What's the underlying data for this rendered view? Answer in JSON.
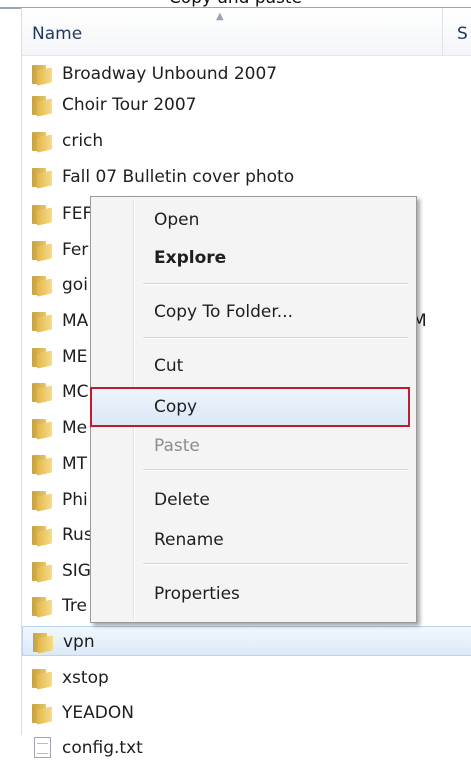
{
  "header": {
    "top_caption": "Copy and paste",
    "column_name": "Name",
    "column_next": "S"
  },
  "items": [
    {
      "label": "Broadway Unbound 2007",
      "type": "folder"
    },
    {
      "label": "Choir Tour 2007",
      "type": "folder"
    },
    {
      "label": "crich",
      "type": "folder"
    },
    {
      "label": "Fall 07 Bulletin cover photo",
      "type": "folder"
    },
    {
      "label": "FEF",
      "type": "folder"
    },
    {
      "label": "Fer",
      "type": "folder"
    },
    {
      "label": "goi",
      "type": "folder"
    },
    {
      "label": "MA",
      "type": "folder"
    },
    {
      "label": "ME",
      "type": "folder"
    },
    {
      "label": "MC",
      "type": "folder"
    },
    {
      "label": "Me",
      "type": "folder"
    },
    {
      "label": "MT",
      "type": "folder"
    },
    {
      "label": "Phi",
      "type": "folder"
    },
    {
      "label": "Rus",
      "type": "folder"
    },
    {
      "label": "SIG",
      "type": "folder"
    },
    {
      "label": "Tre",
      "type": "folder"
    },
    {
      "label": "vpn",
      "type": "folder",
      "selected": true
    },
    {
      "label": "xstop",
      "type": "folder"
    },
    {
      "label": "YEADON",
      "type": "folder"
    },
    {
      "label": "config.txt",
      "type": "file"
    }
  ],
  "overflow_text": "M",
  "context_menu": {
    "items": [
      {
        "label": "Open"
      },
      {
        "label": "Explore",
        "bold": true
      },
      {
        "label": "Copy To Folder..."
      },
      {
        "label": "Cut"
      },
      {
        "label": "Copy",
        "highlighted": true
      },
      {
        "label": "Paste",
        "disabled": true
      },
      {
        "label": "Delete"
      },
      {
        "label": "Rename"
      },
      {
        "label": "Properties"
      }
    ]
  },
  "colors": {
    "highlight_border": "#c21b2e",
    "selection_bg": "#dbeaf8",
    "folder": "#e7c76b"
  }
}
